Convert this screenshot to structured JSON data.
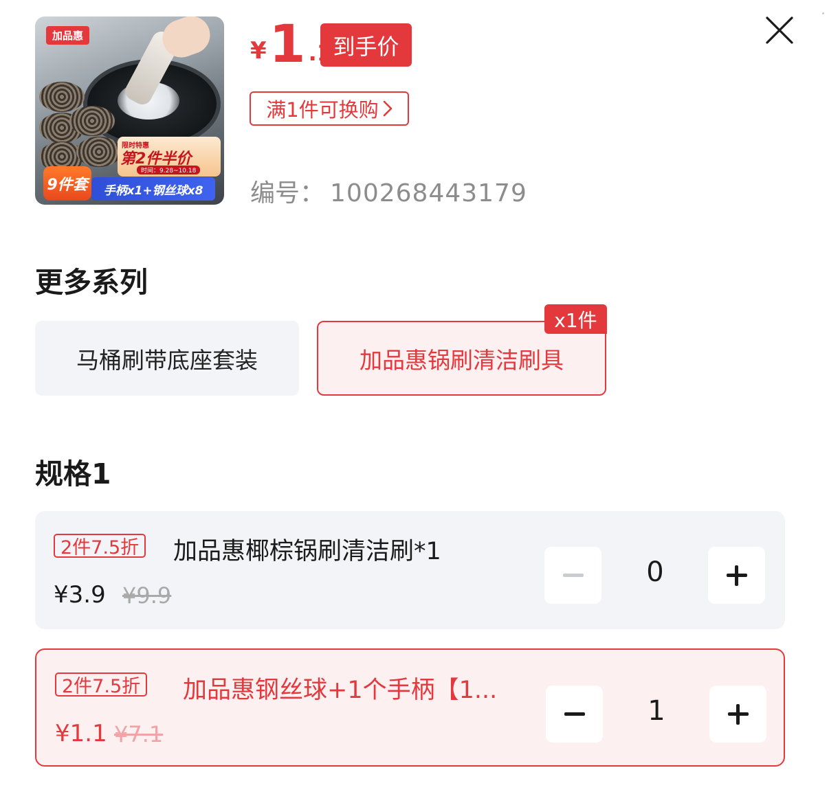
{
  "product": {
    "thumb_badge": "加品惠",
    "thumb_promo_line1": "限时特惠",
    "thumb_promo_line2": "第2件半价",
    "thumb_promo_date": "时间：9.28~10.18",
    "thumb_set": "9件套",
    "thumb_combo": "手柄x1+钢丝球x8",
    "price_symbol": "¥",
    "price_integer": "1",
    "price_decimal": ".1",
    "final_price_tag": "到手价",
    "swap_link": "满1件可换购",
    "sku_label": "编号：",
    "sku_value": "100268443179"
  },
  "series": {
    "title": "更多系列",
    "items": [
      {
        "label": "马桶刷带底座套装",
        "selected": false
      },
      {
        "label": "加品惠锅刷清洁刷具",
        "selected": true,
        "badge": "x1件"
      }
    ]
  },
  "spec": {
    "title": "规格1",
    "items": [
      {
        "discount": "2件7.5折",
        "name": "加品惠椰棕锅刷清洁刷*1",
        "price": "¥3.9",
        "original_price": "¥9.9",
        "quantity": "0",
        "selected": false
      },
      {
        "discount": "2件7.5折",
        "name": "加品惠钢丝球+1个手柄【1...",
        "price": "¥1.1",
        "original_price": "¥7.1",
        "quantity": "1",
        "selected": true
      }
    ]
  },
  "colors": {
    "accent": "#e4393c",
    "selected_bg": "#fdf0f1",
    "card_bg": "#f3f4f7"
  },
  "icons": [
    "close-icon",
    "chevron-right-icon",
    "minus-icon",
    "plus-icon"
  ]
}
